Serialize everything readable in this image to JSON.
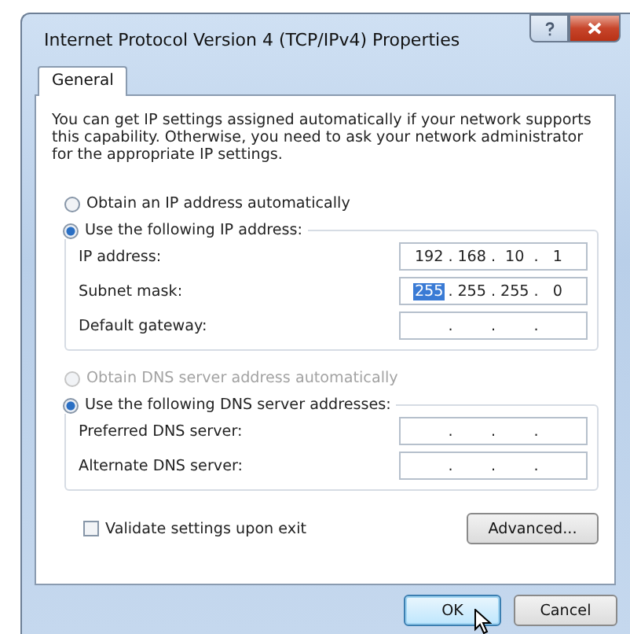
{
  "window": {
    "title": "Internet Protocol Version 4 (TCP/IPv4) Properties"
  },
  "tabs": [
    {
      "label": "General",
      "selected": true
    }
  ],
  "description": "You can get IP settings assigned automatically if your network supports this capability. Otherwise, you need to ask your network administrator for the appropriate IP settings.",
  "ip_radios": [
    {
      "label": "Obtain an IP address automatically",
      "selected": false,
      "disabled": false
    },
    {
      "label": "Use the following IP address:",
      "selected": true,
      "disabled": false
    }
  ],
  "ip_fields": [
    {
      "label": "IP address:",
      "separator": ".",
      "octets": [
        {
          "text": "192",
          "selected": false
        },
        {
          "text": "168",
          "selected": false
        },
        {
          "text": "10",
          "selected": false
        },
        {
          "text": "1",
          "selected": false
        }
      ]
    },
    {
      "label": "Subnet mask:",
      "separator": ".",
      "octets": [
        {
          "text": "255",
          "selected": true
        },
        {
          "text": "255",
          "selected": false
        },
        {
          "text": "255",
          "selected": false
        },
        {
          "text": "0",
          "selected": false
        }
      ]
    },
    {
      "label": "Default gateway:",
      "separator": "."
    }
  ],
  "dns_radios": [
    {
      "label": "Obtain DNS server address automatically",
      "selected": false,
      "disabled": true
    },
    {
      "label": "Use the following DNS server addresses:",
      "selected": true,
      "disabled": false
    }
  ],
  "dns_fields": [
    {
      "label": "Preferred DNS server:",
      "separator": "."
    },
    {
      "label": "Alternate DNS server:",
      "separator": "."
    }
  ],
  "validate": {
    "label": "Validate settings upon exit",
    "checked": false
  },
  "advanced_button": "Advanced...",
  "buttons": [
    {
      "label": "OK",
      "focused": true
    },
    {
      "label": "Cancel",
      "focused": false
    }
  ]
}
